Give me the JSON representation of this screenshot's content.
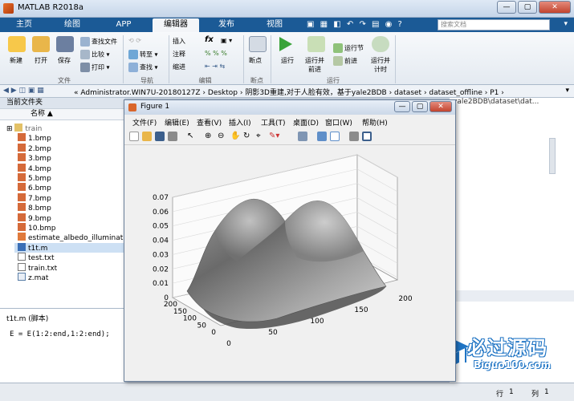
{
  "app": {
    "title": "MATLAB R2018a"
  },
  "tabs": [
    "主页",
    "绘图",
    "APP",
    "编辑器",
    "发布",
    "视图"
  ],
  "active_tab": "编辑器",
  "search": {
    "placeholder": "搜索文档"
  },
  "ribbon": {
    "file": {
      "new": "新建",
      "open": "打开",
      "save": "保存",
      "find_files": "查找文件",
      "compare": "比较",
      "print": "打印",
      "group": "文件"
    },
    "nav": {
      "goto": "转至",
      "find": "查找",
      "group": "导航"
    },
    "edit": {
      "insert": "插入",
      "comment": "注释",
      "indent": "缩进",
      "fx": "fx",
      "group": "编辑"
    },
    "breakpoints": {
      "label": "断点",
      "group": "断点"
    },
    "run": {
      "run": "运行",
      "run_advance": "运行并\n前进",
      "run_section": "运行节",
      "advance": "前进",
      "run_time": "运行并\n计时",
      "group": "运行"
    }
  },
  "address": {
    "path": "«  Administrator.WIN7U-20180127Z  ›  Desktop  ›  阴影3D重建,对于人脸有效，基于yale2BDB  ›  dataset  ›  dataset_offline  ›  P1  ›"
  },
  "current_folder": {
    "header": "当前文件夹",
    "column": "名称 ▲",
    "items": [
      "train",
      "1.bmp",
      "2.bmp",
      "3.bmp",
      "4.bmp",
      "5.bmp",
      "6.bmp",
      "7.bmp",
      "8.bmp",
      "9.bmp",
      "10.bmp",
      "estimate_albedo_illumination",
      "t1t.m",
      "test.txt",
      "train.txt",
      "z.mat"
    ],
    "selected": "t1t.m"
  },
  "details": {
    "header": "t1t.m  (脚本)",
    "code": "E = E(1:2:end,1:2:end);"
  },
  "right_partial_path": "yale2BDB\\dataset\\dat...",
  "figure": {
    "title": "Figure 1",
    "menu": [
      "文件(F)",
      "编辑(E)",
      "查看(V)",
      "插入(I)",
      "工具(T)",
      "桌面(D)",
      "窗口(W)",
      "帮助(H)"
    ]
  },
  "status": {
    "row_label": "行",
    "row": "1",
    "col_label": "列",
    "col": "1"
  },
  "watermark": {
    "text": "必过源码",
    "url_text": "Biguo100.com"
  },
  "chart_data": {
    "type": "surface",
    "zticks": [
      "0.07",
      "0.06",
      "0.05",
      "0.04",
      "0.03",
      "0.02",
      "0.01",
      "0"
    ],
    "yticks": [
      "200",
      "150",
      "100",
      "50",
      "0"
    ],
    "xticks": [
      "0",
      "50",
      "100",
      "150",
      "200"
    ],
    "zlim": [
      0,
      0.07
    ],
    "xlim": [
      0,
      200
    ],
    "ylim": [
      0,
      200
    ],
    "grid": true,
    "colormap": "gray"
  }
}
